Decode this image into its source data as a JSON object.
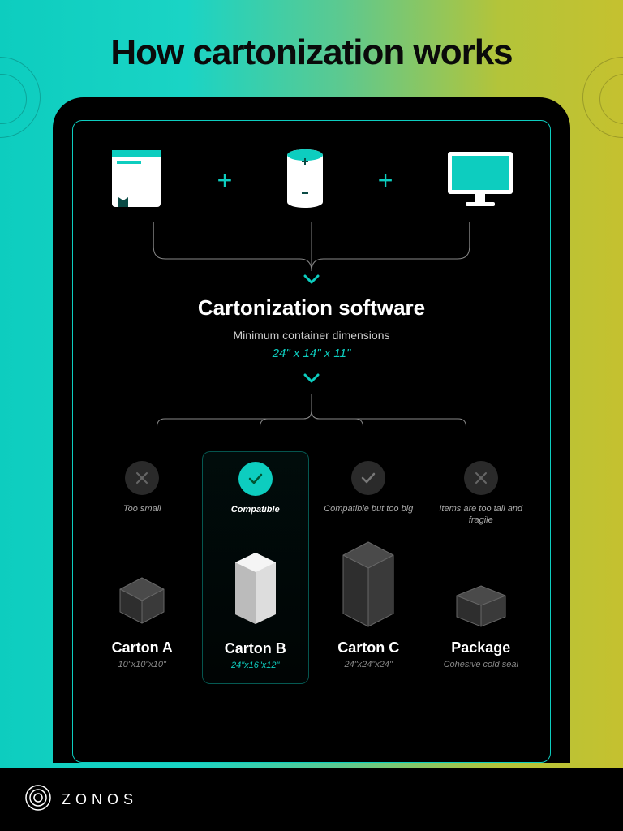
{
  "title": "How cartonization works",
  "software": {
    "title": "Cartonization software",
    "subtitle": "Minimum container dimensions",
    "dimensions": "24\" x 14\" x 11\""
  },
  "cartons": [
    {
      "status": "Too small",
      "statusStyle": "dark-x",
      "name": "Carton A",
      "dims": "10\"x10\"x10\"",
      "highlighted": false,
      "dimClass": ""
    },
    {
      "status": "Compatible",
      "statusStyle": "teal-check",
      "name": "Carton B",
      "dims": "24\"x16\"x12\"",
      "highlighted": true,
      "dimClass": "teal"
    },
    {
      "status": "Compatible but too big",
      "statusStyle": "dark-check",
      "name": "Carton C",
      "dims": "24\"x24\"x24\"",
      "highlighted": false,
      "dimClass": ""
    },
    {
      "status": "Items are too tall and fragile",
      "statusStyle": "dark-x",
      "name": "Package",
      "dims": "Cohesive cold seal",
      "highlighted": false,
      "dimClass": ""
    }
  ],
  "brand": "ZONOS",
  "colors": {
    "accent": "#0dcdbf"
  }
}
